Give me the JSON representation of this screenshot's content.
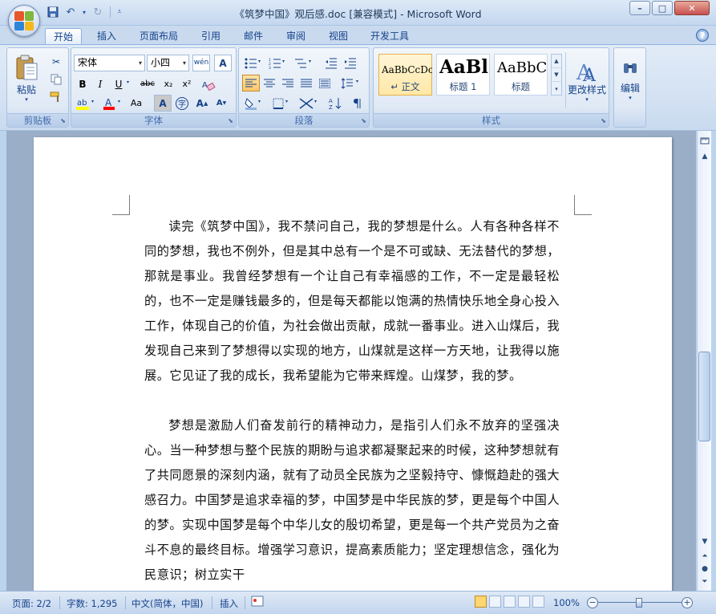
{
  "window": {
    "title": "《筑梦中国》观后感.doc [兼容模式] - Microsoft Word"
  },
  "tabs": [
    "开始",
    "插入",
    "页面布局",
    "引用",
    "邮件",
    "审阅",
    "视图",
    "开发工具"
  ],
  "ribbon": {
    "clipboard": {
      "paste_label": "粘贴",
      "group_label": "剪贴板"
    },
    "font": {
      "font_name": "宋体",
      "font_size": "小四",
      "group_label": "字体",
      "buttons": [
        "B",
        "I",
        "U",
        "abc",
        "x₂",
        "x²",
        "Aa"
      ]
    },
    "paragraph": {
      "group_label": "段落"
    },
    "styles": {
      "items": [
        {
          "sample": "AaBbCcDc",
          "name": "↵ 正文"
        },
        {
          "sample": "AaBl",
          "name": "标题 1"
        },
        {
          "sample": "AaBbC",
          "name": "标题"
        }
      ],
      "change_styles_label": "更改样式",
      "group_label": "样式"
    },
    "editing": {
      "label": "编辑"
    }
  },
  "document": {
    "paragraphs": [
      "读完《筑梦中国》，我不禁问自己，我的梦想是什么。人有各种各样不同的梦想，我也不例外，但是其中总有一个是不可或缺、无法替代的梦想，那就是事业。我曾经梦想有一个让自己有幸福感的工作，不一定是最轻松的，也不一定是赚钱最多的，但是每天都能以饱满的热情快乐地全身心投入工作，体现自己的价值，为社会做出贡献，成就一番事业。进入山煤后，我发现自己来到了梦想得以实现的地方，山煤就是这样一方天地，让我得以施展。它见证了我的成长，我希望能为它带来辉煌。山煤梦，我的梦。",
      "梦想是激励人们奋发前行的精神动力，是指引人们永不放弃的坚强决心。当一种梦想与整个民族的期盼与追求都凝聚起来的时候，这种梦想就有了共同愿景的深刻内涵，就有了动员全民族为之坚毅持守、慷慨趋赴的强大感召力。中国梦是追求幸福的梦，中国梦是中华民族的梦，更是每个中国人的梦。实现中国梦是每个中华儿女的殷切希望，更是每一个共产党员为之奋斗不息的最终目标。增强学习意识，提高素质能力；坚定理想信念，强化为民意识；树立实干"
    ]
  },
  "status": {
    "page": "页面: 2/2",
    "words": "字数: 1,295",
    "language": "中文(简体，中国)",
    "insert_mode": "插入",
    "zoom": "100%",
    "zoom_level_percent": 100
  },
  "colors": {
    "ribbon_text": "#15428b",
    "doc_background": "#9aaec8",
    "page": "#ffffff"
  }
}
